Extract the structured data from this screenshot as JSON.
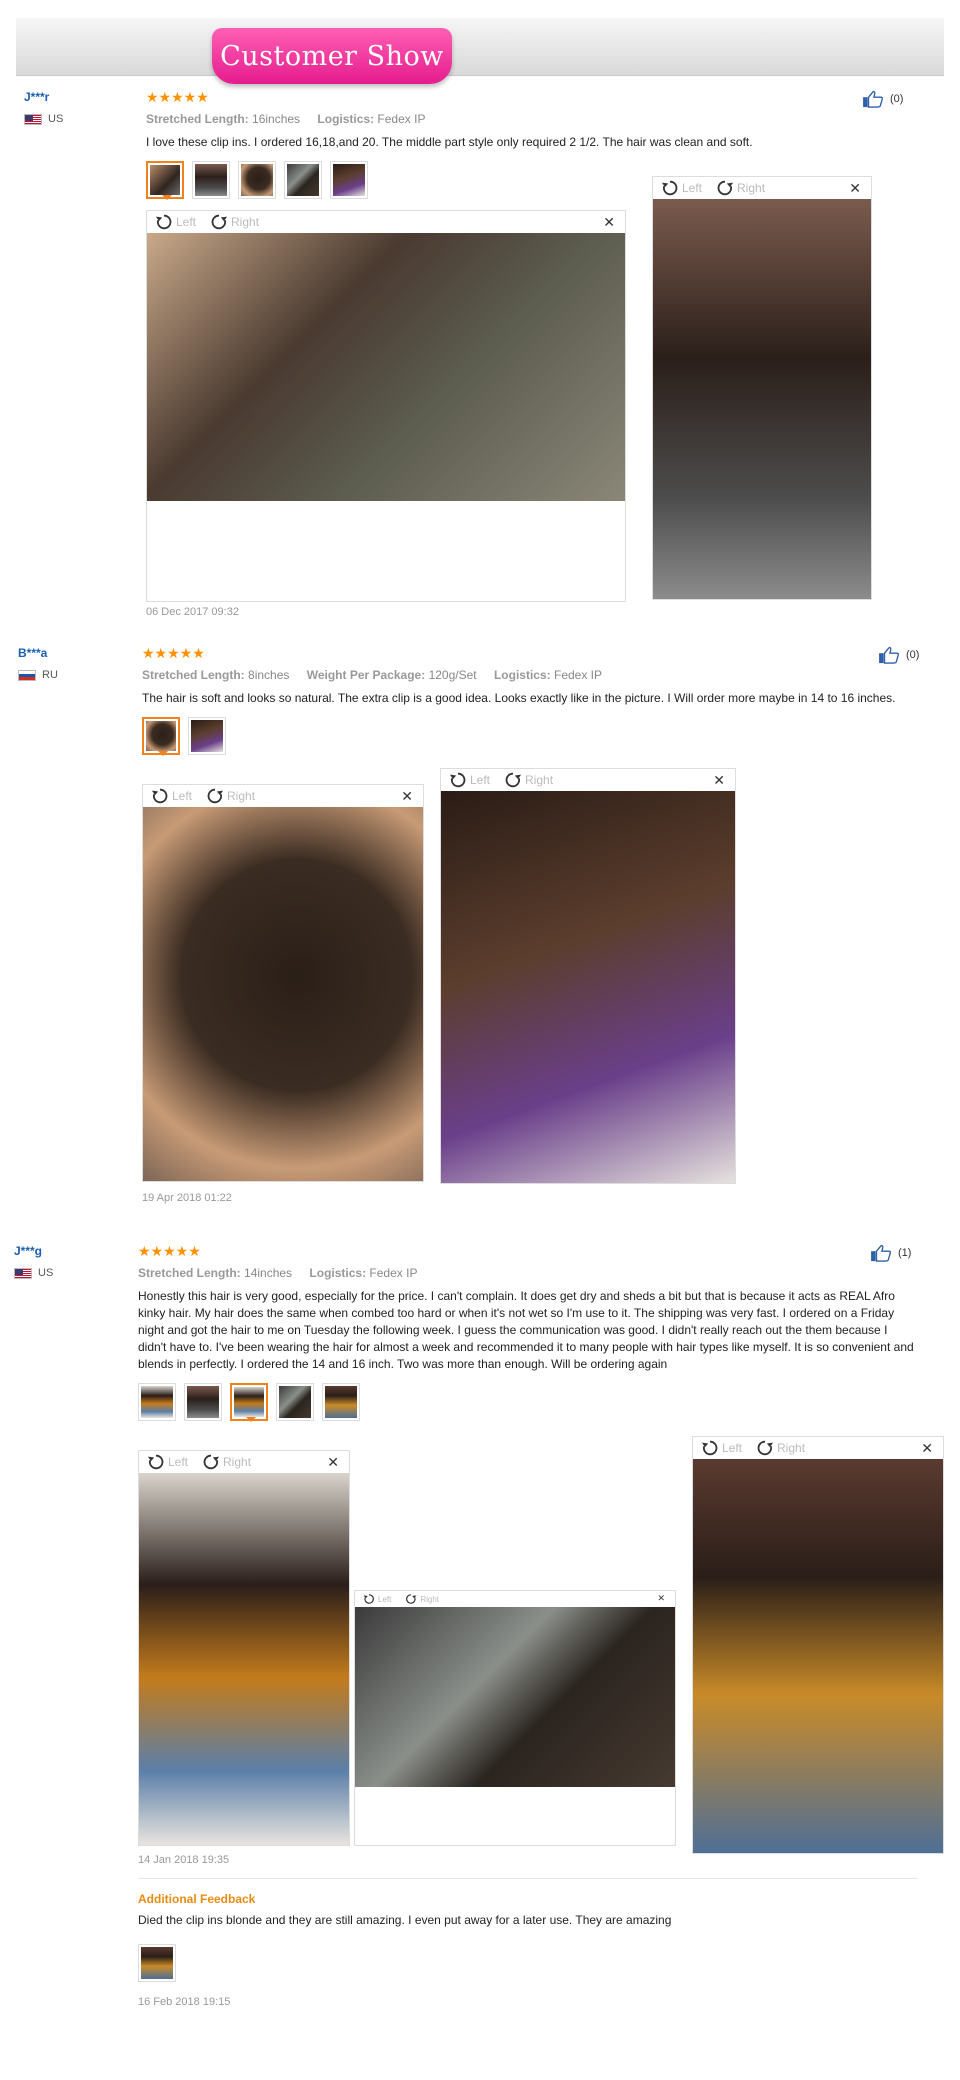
{
  "banner": {
    "title": "Customer Show"
  },
  "icons": {
    "star": "star-icon",
    "like": "thumbs-up-icon",
    "rotate_left": "rotate-left-icon",
    "rotate_right": "rotate-right-icon",
    "close": "close-icon"
  },
  "colors": {
    "brand_pink": "#e51c8e",
    "star_orange": "#ff9000",
    "user_blue": "#1a5fb4",
    "accent_orange": "#e98b12"
  },
  "viewer": {
    "left_label": "Left",
    "right_label": "Right",
    "close_label": "✕"
  },
  "reviews": [
    {
      "user": "J***r",
      "country": "US",
      "stars": "★★★★★",
      "rating": 5,
      "attrs": [
        {
          "key": "Stretched Length:",
          "value": "16inches"
        },
        {
          "key": "Logistics:",
          "value": "Fedex IP"
        }
      ],
      "text": "I love these clip ins. I ordered 16,18,and 20. The middle part style only required 2 1/2. The hair was clean and soft.",
      "likes": "(0)",
      "thumb_count": 5,
      "date": "06 Dec 2017 09:32"
    },
    {
      "user": "B***a",
      "country": "RU",
      "stars": "★★★★★",
      "rating": 5,
      "attrs": [
        {
          "key": "Stretched Length:",
          "value": "8inches"
        },
        {
          "key": "Weight Per Package:",
          "value": "120g/Set"
        },
        {
          "key": "Logistics:",
          "value": "Fedex IP"
        }
      ],
      "text": "The hair is soft and looks so natural. The extra clip is a good idea. Looks exactly like in the picture. I Will order more maybe in 14 to 16 inches.",
      "likes": "(0)",
      "thumb_count": 2,
      "date": "19 Apr 2018 01:22"
    },
    {
      "user": "J***g",
      "country": "US",
      "stars": "★★★★★",
      "rating": 5,
      "attrs": [
        {
          "key": "Stretched Length:",
          "value": "14inches"
        },
        {
          "key": "Logistics:",
          "value": "Fedex IP"
        }
      ],
      "text": "Honestly this hair is very good, especially for the price. I can't complain. It does get dry and sheds a bit but that is because it acts as REAL Afro kinky hair. My hair does the same when combed too hard or when it's not wet so I'm use to it. The shipping was very fast. I ordered on a Friday night and got the hair to me on Tuesday the following week. I guess the communication was good. I didn't really reach out the them because I didn't have to. I've been wearing the hair for almost a week and recommended it to many people with hair types like myself. It is so convenient and blends in perfectly. I ordered the 14 and 16 inch. Two was more than enough. Will be ordering again",
      "likes": "(1)",
      "thumb_count": 5,
      "date": "14 Jan 2018 19:35",
      "additional": {
        "title": "Additional Feedback",
        "text": "Died the clip ins blonde and they are still amazing. I even put away for a later use. They are amazing",
        "date": "16 Feb 2018 19:15"
      }
    }
  ]
}
